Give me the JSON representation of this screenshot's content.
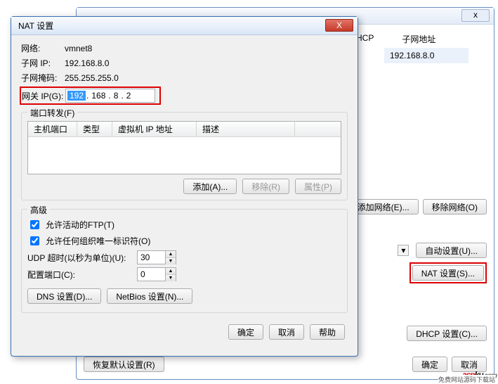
{
  "bg": {
    "close_x": "x",
    "col_hcp": "HCP",
    "col_subnet": "子网地址",
    "row_subnet_val": "192.168.8.0",
    "add_net": "添加网络(E)...",
    "remove_net": "移除网络(O)",
    "auto_settings": "自动设置(U)...",
    "nat_settings": "NAT 设置(S)...",
    "dhcp_settings": "DHCP 设置(C)...",
    "restore_default": "恢复默认设置(R)",
    "ok": "确定",
    "cancel": "取消"
  },
  "modal": {
    "title": "NAT 设置",
    "close_x": "X",
    "network_label": "网络:",
    "network_val": "vmnet8",
    "subnet_ip_label": "子网 IP:",
    "subnet_ip_val": "192.168.8.0",
    "subnet_mask_label": "子网掩码:",
    "subnet_mask_val": "255.255.255.0",
    "gateway_label": "网关 IP(G):",
    "gateway_ip": {
      "seg1": "192",
      "seg2": "168",
      "seg3": "8",
      "seg4": "2"
    },
    "port_forward_title": "端口转发(F)",
    "list": {
      "col1": "主机端口",
      "col2": "类型",
      "col3": "虚拟机 IP 地址",
      "col4": "描述"
    },
    "add": "添加(A)...",
    "remove": "移除(R)",
    "properties": "属性(P)",
    "advanced_title": "高级",
    "allow_active_ftp": "允许活动的FTP(T)",
    "allow_any_oui": "允许任何组织唯一标识符(O)",
    "udp_timeout_label": "UDP 超时(以秒为单位)(U):",
    "udp_timeout_val": "30",
    "config_port_label": "配置端口(C):",
    "config_port_val": "0",
    "dns_settings": "DNS 设置(D)...",
    "netbios_settings": "NetBios 设置(N)...",
    "ok": "确定",
    "cancel": "取消",
    "help": "帮助"
  },
  "watermark": {
    "prefix": "asp",
    "suffix": "ku",
    "dotcom": ".com",
    "sub": "免费网站源码下载站"
  }
}
